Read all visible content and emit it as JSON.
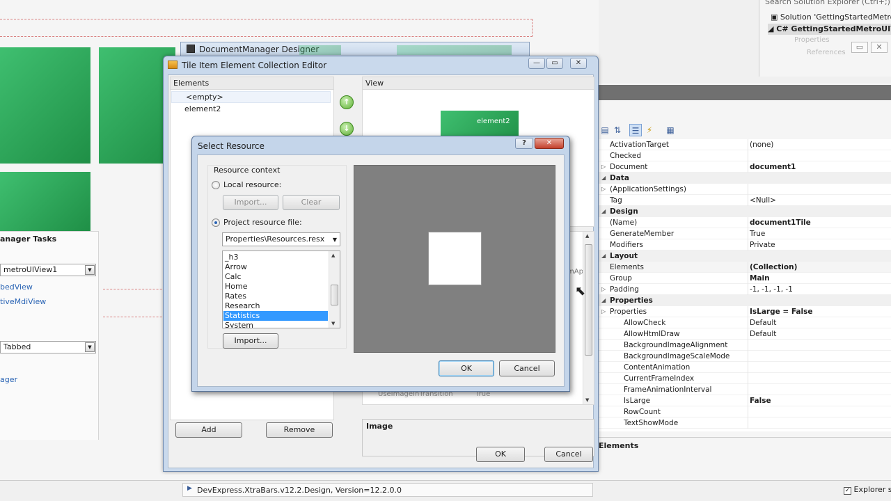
{
  "solution_explorer": {
    "search_placeholder": "Search Solution Explorer (Ctrl+;)",
    "solution_label": "Solution 'GettingStartedMetroU",
    "project_label": "GettingStartedMetroUIVi",
    "properties_label": "Properties",
    "references_label": "References"
  },
  "tasks_panel": {
    "title": "anager Tasks",
    "view_combo": "metroUIView1",
    "link_tabbed": "bedView",
    "link_native_mdi": "tiveMdiView",
    "mode_combo": "Tabbed",
    "link_manager": "ager"
  },
  "dm_designer": {
    "title": "DocumentManager Designer"
  },
  "collection_editor": {
    "title": "Tile Item Element Collection Editor",
    "elements_header": "Elements",
    "view_header": "View",
    "elements": [
      "<empty>",
      "element2"
    ],
    "preview_tile_label": "element2",
    "add_label": "Add",
    "remove_label": "Remove",
    "ok_label": "OK",
    "cancel_label": "Cancel",
    "bg_property_name": "UseImageInTransition",
    "bg_property_value": "True",
    "bg_property_trunc": "mAp",
    "desc_title": "Image"
  },
  "select_resource": {
    "title": "Select Resource",
    "help_label": "?",
    "resource_context_label": "Resource context",
    "local_resource_label": "Local resource:",
    "import_label_disabled": "Import...",
    "clear_label": "Clear",
    "project_resource_label": "Project resource file:",
    "resource_file_value": "Properties\\Resources.resx",
    "resources": [
      "_h3",
      "Arrow",
      "Calc",
      "Home",
      "Rates",
      "Research",
      "Statistics",
      "System"
    ],
    "selected_resource": "Statistics",
    "import_label": "Import...",
    "ok_label": "OK",
    "cancel_label": "Cancel"
  },
  "properties": {
    "rows": [
      {
        "name": "ActivationTarget",
        "value": "(none)",
        "type": "prop"
      },
      {
        "name": "Checked",
        "value": "",
        "type": "prop"
      },
      {
        "name": "Document",
        "value": "document1",
        "type": "prop",
        "bold_value": true,
        "expand": true
      },
      {
        "name": "Data",
        "value": "",
        "type": "cat"
      },
      {
        "name": "(ApplicationSettings)",
        "value": "",
        "type": "prop",
        "expand": true
      },
      {
        "name": "Tag",
        "value": "<Null>",
        "type": "prop"
      },
      {
        "name": "Design",
        "value": "",
        "type": "cat"
      },
      {
        "name": "(Name)",
        "value": "document1Tile",
        "type": "prop",
        "bold_value": true
      },
      {
        "name": "GenerateMember",
        "value": "True",
        "type": "prop"
      },
      {
        "name": "Modifiers",
        "value": "Private",
        "type": "prop"
      },
      {
        "name": "Layout",
        "value": "",
        "type": "cat"
      },
      {
        "name": "Elements",
        "value": "(Collection)",
        "type": "prop",
        "bold_value": true,
        "selected": true
      },
      {
        "name": "Group",
        "value": "Main",
        "type": "prop",
        "bold_value": true
      },
      {
        "name": "Padding",
        "value": "-1, -1, -1, -1",
        "type": "prop",
        "expand": true
      },
      {
        "name": "Properties",
        "value": "",
        "type": "cat"
      },
      {
        "name": "Properties",
        "value": "IsLarge = False",
        "type": "prop",
        "bold_value": true,
        "expand": true
      },
      {
        "name": "AllowCheck",
        "value": "Default",
        "type": "sub"
      },
      {
        "name": "AllowHtmlDraw",
        "value": "Default",
        "type": "sub"
      },
      {
        "name": "BackgroundImageAlignment",
        "value": "",
        "type": "sub"
      },
      {
        "name": "BackgroundImageScaleMode",
        "value": "",
        "type": "sub"
      },
      {
        "name": "ContentAnimation",
        "value": "",
        "type": "sub"
      },
      {
        "name": "CurrentFrameIndex",
        "value": "",
        "type": "sub"
      },
      {
        "name": "FrameAnimationInterval",
        "value": "",
        "type": "sub"
      },
      {
        "name": "IsLarge",
        "value": "False",
        "type": "sub",
        "bold_value": true
      },
      {
        "name": "RowCount",
        "value": "",
        "type": "sub"
      },
      {
        "name": "TextShowMode",
        "value": "",
        "type": "sub"
      }
    ],
    "description_title": "Elements"
  },
  "status_bar": {
    "assembly_text": "DevExpress.XtraBars.v12.2.Design, Version=12.2.0.0",
    "explorer_label": "Explorer sty"
  },
  "colors": {
    "tile_green": "#2ea05a",
    "selection_blue": "#3399ff",
    "preview_gray": "#808080"
  }
}
